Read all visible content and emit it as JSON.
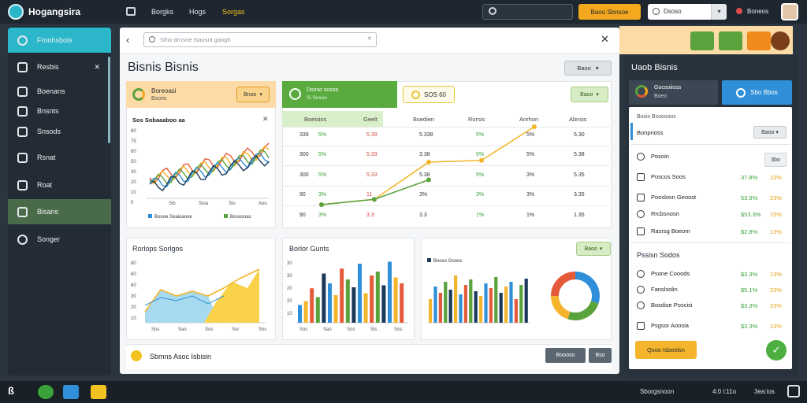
{
  "topbar": {
    "brand": "Hogangsira",
    "nav": [
      "Borgks",
      "Hogs",
      "Sorgas"
    ],
    "cta": "Baoo Sbnsoe",
    "select_value": "Dsoso",
    "user": "Boneos"
  },
  "sidebar": {
    "items": [
      {
        "label": "Froohsbois",
        "icon": "dashboard-icon",
        "active": true
      },
      {
        "label": "Resbis",
        "icon": "reports-icon"
      },
      {
        "label": "Boenans",
        "icon": "stack-icon"
      },
      {
        "label": "Bnsnts",
        "icon": "document-icon"
      },
      {
        "label": "Snsods",
        "icon": "folder-icon"
      },
      {
        "label": "Rsnat",
        "icon": "cart-icon"
      },
      {
        "label": "Roat",
        "icon": "tag-icon"
      },
      {
        "label": "Bisans",
        "icon": "chart-icon",
        "highlight": true
      },
      {
        "label": "Songer",
        "icon": "user-icon"
      }
    ]
  },
  "main": {
    "search_placeholder": "Sfno drnsne tsaosnt gaogh",
    "title": "Bisnis Bisnis",
    "title_button": "Baoo",
    "card1": {
      "line1": "Boreoasi",
      "line2": "Bsoris",
      "button": "Bnoo",
      "subtitle": "Sos Sobaaaboo aa",
      "legend": [
        "Boooe Soaioaooe",
        "Booosoas"
      ]
    },
    "card2": {
      "line1": "Dsoso sosoo",
      "line2": "Si Sosoo",
      "pill": "SOS 60",
      "select": "Baoo",
      "columns": [
        "Boeisios",
        "Geelt",
        "Bsedien",
        "Rorsis",
        "Anrhon",
        "Abnsis"
      ],
      "rows": [
        {
          "a": "339",
          "b": "5%",
          "c": "5.39",
          "d": "5.338",
          "e": "5%",
          "f": "5%",
          "g": "5.30"
        },
        {
          "a": "300",
          "b": "5%",
          "c": "5.33",
          "d": "3.38",
          "e": "5%",
          "f": "5%",
          "g": "5.38"
        },
        {
          "a": "300",
          "b": "5%",
          "c": "5.33",
          "d": "5.38",
          "e": "5%",
          "f": "3%",
          "g": "5.35"
        },
        {
          "a": "90",
          "b": "3%",
          "c": "11",
          "d": "3%",
          "e": "3%",
          "f": "3%",
          "g": "3.35"
        },
        {
          "a": "90",
          "b": "3%",
          "c": "3.3",
          "d": "3.3",
          "e": "1%",
          "f": "1%",
          "g": "1.35"
        }
      ]
    },
    "card3_title": "Rorlops Sorlgos",
    "card4_title": "Borlor Gunts",
    "card5": {
      "legend": "Booso Gooos",
      "select": "Baoo"
    },
    "bottom": {
      "label": "Sbmns Asoc Isbisin",
      "button1": "Boooso",
      "button2": "Bso"
    }
  },
  "right": {
    "title": "Uaob Bisnis",
    "card1_line1": "Gocsoiioss",
    "card1_line2": "Boeo",
    "card2": "Sbo Bbos",
    "list_header": "Bosis Bsoosoos",
    "dropdown_label": "Bonpnoss",
    "dropdown": "Baoo",
    "dropdown2": "3bo",
    "items": [
      {
        "label": "Posoin",
        "icon": "clock-icon"
      },
      {
        "label": "Poscos Soos",
        "icon": "checkbox-icon",
        "v1": "37.8%",
        "v2": "23%"
      },
      {
        "label": "Pooslosn Geoost",
        "icon": "checkbox-icon",
        "v1": "53.9%",
        "v2": "23%"
      },
      {
        "label": "Rrcbsnosn",
        "icon": "search-icon",
        "v1": "$53.3%",
        "v2": "15%"
      },
      {
        "label": "Rasrsg Boeom",
        "icon": "checkbox-icon",
        "v1": "$2.8%",
        "v2": "13%"
      }
    ],
    "section_title": "Pssisn Sodos",
    "items2": [
      {
        "label": "Psone Cooods",
        "icon": "clock-icon",
        "v1": "$3.3%",
        "v2": "13%"
      },
      {
        "label": "Fanslsolin",
        "icon": "clock-icon",
        "v1": "$5.1%",
        "v2": "23%"
      },
      {
        "label": "Bosdise Poscisi",
        "icon": "clock-icon",
        "v1": "$3.3%",
        "v2": "23%"
      },
      {
        "label": "Psgsor Aoosia",
        "icon": "edit-icon",
        "v1": "$3.3%",
        "v2": "13%"
      }
    ],
    "cta": "Qsoo Isboolsn"
  },
  "taskbar": {
    "user": "Sborgsnoon",
    "time": "4:0 i:11o",
    "extra": "3ea:ios"
  },
  "chart_data": [
    {
      "type": "area",
      "title": "Sos Sobaaaboo aa",
      "categories": [
        "Sib",
        "Sioa",
        "Sio",
        "Aoo"
      ],
      "ylabel": "",
      "ylim": [
        0,
        80
      ],
      "y_ticks": [
        "80",
        "75",
        "60",
        "50",
        "30",
        "20",
        "10",
        "0"
      ],
      "series": [
        {
          "name": "Boooe Soaioaooe",
          "color": "#2f8fd8"
        },
        {
          "name": "Booosoas",
          "color": "#5aa23c"
        }
      ]
    },
    {
      "type": "line",
      "categories": [
        "339",
        "300",
        "300",
        "90",
        "90"
      ],
      "series": [
        {
          "values": [
            90,
            105,
            210,
            215,
            310
          ],
          "color": "#f4b52c"
        },
        {
          "values": [
            90,
            105,
            160
          ],
          "color": "#5aa23c"
        }
      ]
    },
    {
      "type": "area",
      "title": "Rorlops Sorlgos",
      "categories": [
        "Sos",
        "Sao",
        "Sos",
        "Sor",
        "Sos"
      ],
      "y_ticks": [
        "80",
        "60",
        "60",
        "30",
        "20",
        "10"
      ],
      "series": [
        {
          "name": "blue",
          "color": "#5bbbe0"
        },
        {
          "name": "yellow",
          "color": "#f4c220"
        }
      ]
    },
    {
      "type": "bar",
      "title": "Borlor Gunts",
      "categories": [
        "Sos",
        "Sao",
        "Sos",
        "Sis",
        "Sos"
      ],
      "y_ticks": [
        "30",
        "30",
        "20",
        "20",
        "10"
      ],
      "values": [
        18,
        22,
        35,
        26,
        50,
        40,
        28,
        55,
        44,
        36,
        60,
        30,
        48,
        52,
        38,
        62,
        46,
        40
      ]
    },
    {
      "type": "bar",
      "title": "Booso Gooos",
      "values": [
        30,
        46,
        38,
        52,
        42,
        60,
        36,
        48,
        55,
        40,
        34,
        50,
        44,
        58,
        38,
        46,
        52,
        30,
        48,
        56
      ]
    },
    {
      "type": "pie",
      "values": [
        30,
        25,
        20,
        25
      ],
      "colors": [
        "#2f8fd8",
        "#5aa23c",
        "#f4b52c",
        "#e45a3a"
      ]
    }
  ]
}
